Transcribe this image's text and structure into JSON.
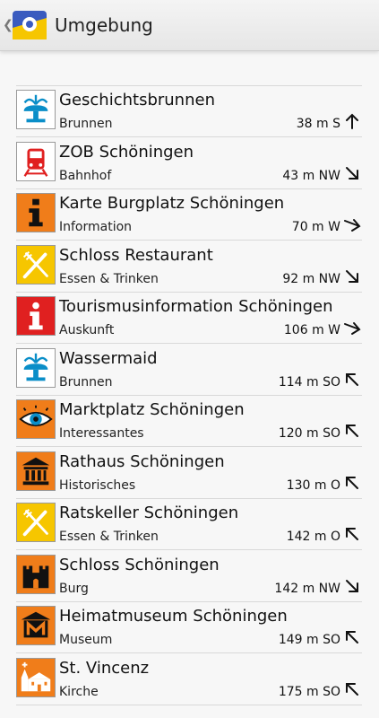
{
  "header": {
    "title": "Umgebung"
  },
  "colors": {
    "orange": "#f07d1a",
    "yellow": "#f6c600",
    "red": "#e02020",
    "white": "#ffffff"
  },
  "items": [
    {
      "name": "Geschichtsbrunnen",
      "category": "Brunnen",
      "distance": "38 m S",
      "icon": "fountain-icon",
      "direction": "north"
    },
    {
      "name": "ZOB Schöningen",
      "category": "Bahnhof",
      "distance": "43 m NW",
      "icon": "train-icon",
      "direction": "southeast"
    },
    {
      "name": "Karte Burgplatz Schöningen",
      "category": "Information",
      "distance": "70 m W",
      "icon": "info-icon",
      "direction": "east-southeast"
    },
    {
      "name": "Schloss Restaurant",
      "category": "Essen & Trinken",
      "distance": "92 m NW",
      "icon": "restaurant-icon",
      "direction": "southeast"
    },
    {
      "name": "Tourismusinformation Schöningen",
      "category": "Auskunft",
      "distance": "106 m W",
      "icon": "tourist-info-icon",
      "direction": "east-southeast"
    },
    {
      "name": "Wassermaid",
      "category": "Brunnen",
      "distance": "114 m SO",
      "icon": "fountain-icon",
      "direction": "northwest"
    },
    {
      "name": "Marktplatz Schöningen",
      "category": "Interessantes",
      "distance": "120 m SO",
      "icon": "eye-icon",
      "direction": "northwest"
    },
    {
      "name": "Rathaus Schöningen",
      "category": "Historisches",
      "distance": "130 m O",
      "icon": "historic-building-icon",
      "direction": "northwest"
    },
    {
      "name": "Ratskeller Schöningen",
      "category": "Essen & Trinken",
      "distance": "142 m O",
      "icon": "restaurant-icon",
      "direction": "northwest"
    },
    {
      "name": "Schloss Schöningen",
      "category": "Burg",
      "distance": "142 m NW",
      "icon": "castle-icon",
      "direction": "southeast"
    },
    {
      "name": "Heimatmuseum Schöningen",
      "category": "Museum",
      "distance": "149 m SO",
      "icon": "museum-icon",
      "direction": "northwest"
    },
    {
      "name": "St. Vincenz",
      "category": "Kirche",
      "distance": "175 m SO",
      "icon": "church-icon",
      "direction": "northwest"
    }
  ]
}
